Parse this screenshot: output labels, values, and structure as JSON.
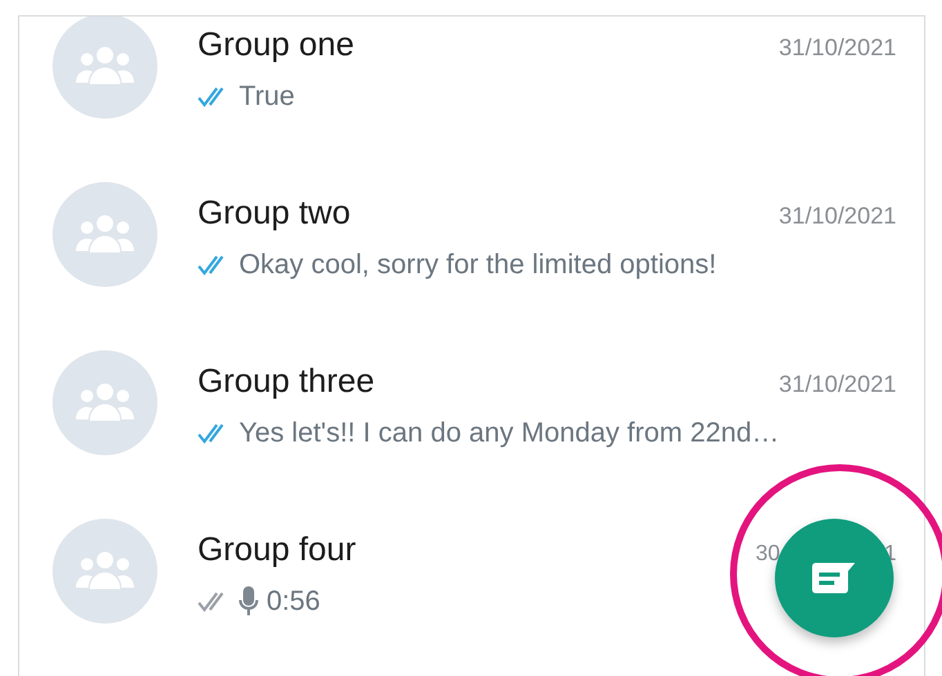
{
  "chats": [
    {
      "name": "Group one",
      "date_parts": [
        "31/10/2021"
      ],
      "read": true,
      "kind": "text",
      "preview": "True"
    },
    {
      "name": "Group two",
      "date_parts": [
        "31/10/2021"
      ],
      "read": true,
      "kind": "text",
      "preview": "Okay cool, sorry for the limited options!"
    },
    {
      "name": "Group three",
      "date_parts": [
        "31/10/2021"
      ],
      "read": true,
      "kind": "text",
      "preview": "Yes let's!! I can do any Monday from 22nd…"
    },
    {
      "name": "Group four",
      "date_parts": [
        "30",
        "1"
      ],
      "read": false,
      "kind": "voice",
      "preview": "0:56"
    }
  ],
  "fab": {
    "highlighted": true
  }
}
